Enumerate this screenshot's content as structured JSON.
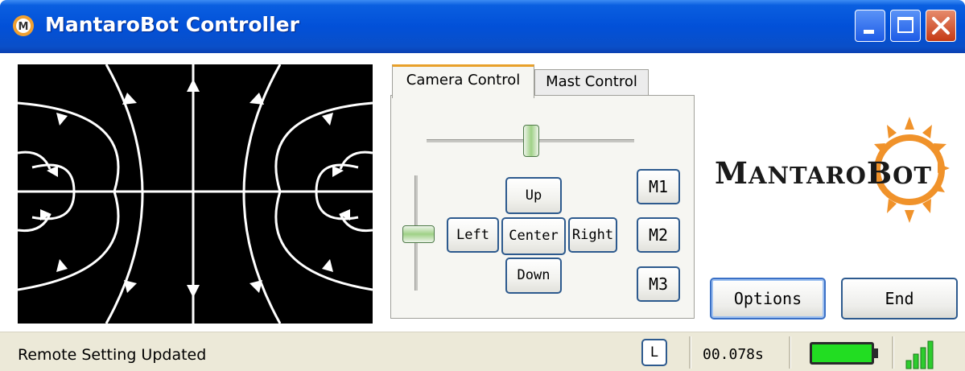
{
  "window": {
    "title": "MantaroBot Controller",
    "controls": [
      "minimize",
      "maximize",
      "close"
    ]
  },
  "video": {
    "icon": "video-feed"
  },
  "tabs": [
    {
      "label": "Camera Control",
      "active": true
    },
    {
      "label": "Mast Control",
      "active": false
    }
  ],
  "camera": {
    "buttons": {
      "up": "Up",
      "left": "Left",
      "center": "Center",
      "right": "Right",
      "down": "Down"
    },
    "memory": [
      "M1",
      "M2",
      "M3"
    ]
  },
  "logo": {
    "big_m": "M",
    "rest": "ANTARO",
    "big_b": "B",
    "end": "OT"
  },
  "actions": {
    "options": "Options",
    "end": "End"
  },
  "status": {
    "message": "Remote Setting Updated",
    "l_label": "L",
    "latency": "00.078s",
    "battery_color": "#22dd22",
    "signal_icon": "signal-strength-icon"
  },
  "colors": {
    "titlebar": "#0250d8",
    "button_border": "#2d5a8e",
    "tab_accent": "#e8a02a",
    "sun": "#f0922a"
  }
}
